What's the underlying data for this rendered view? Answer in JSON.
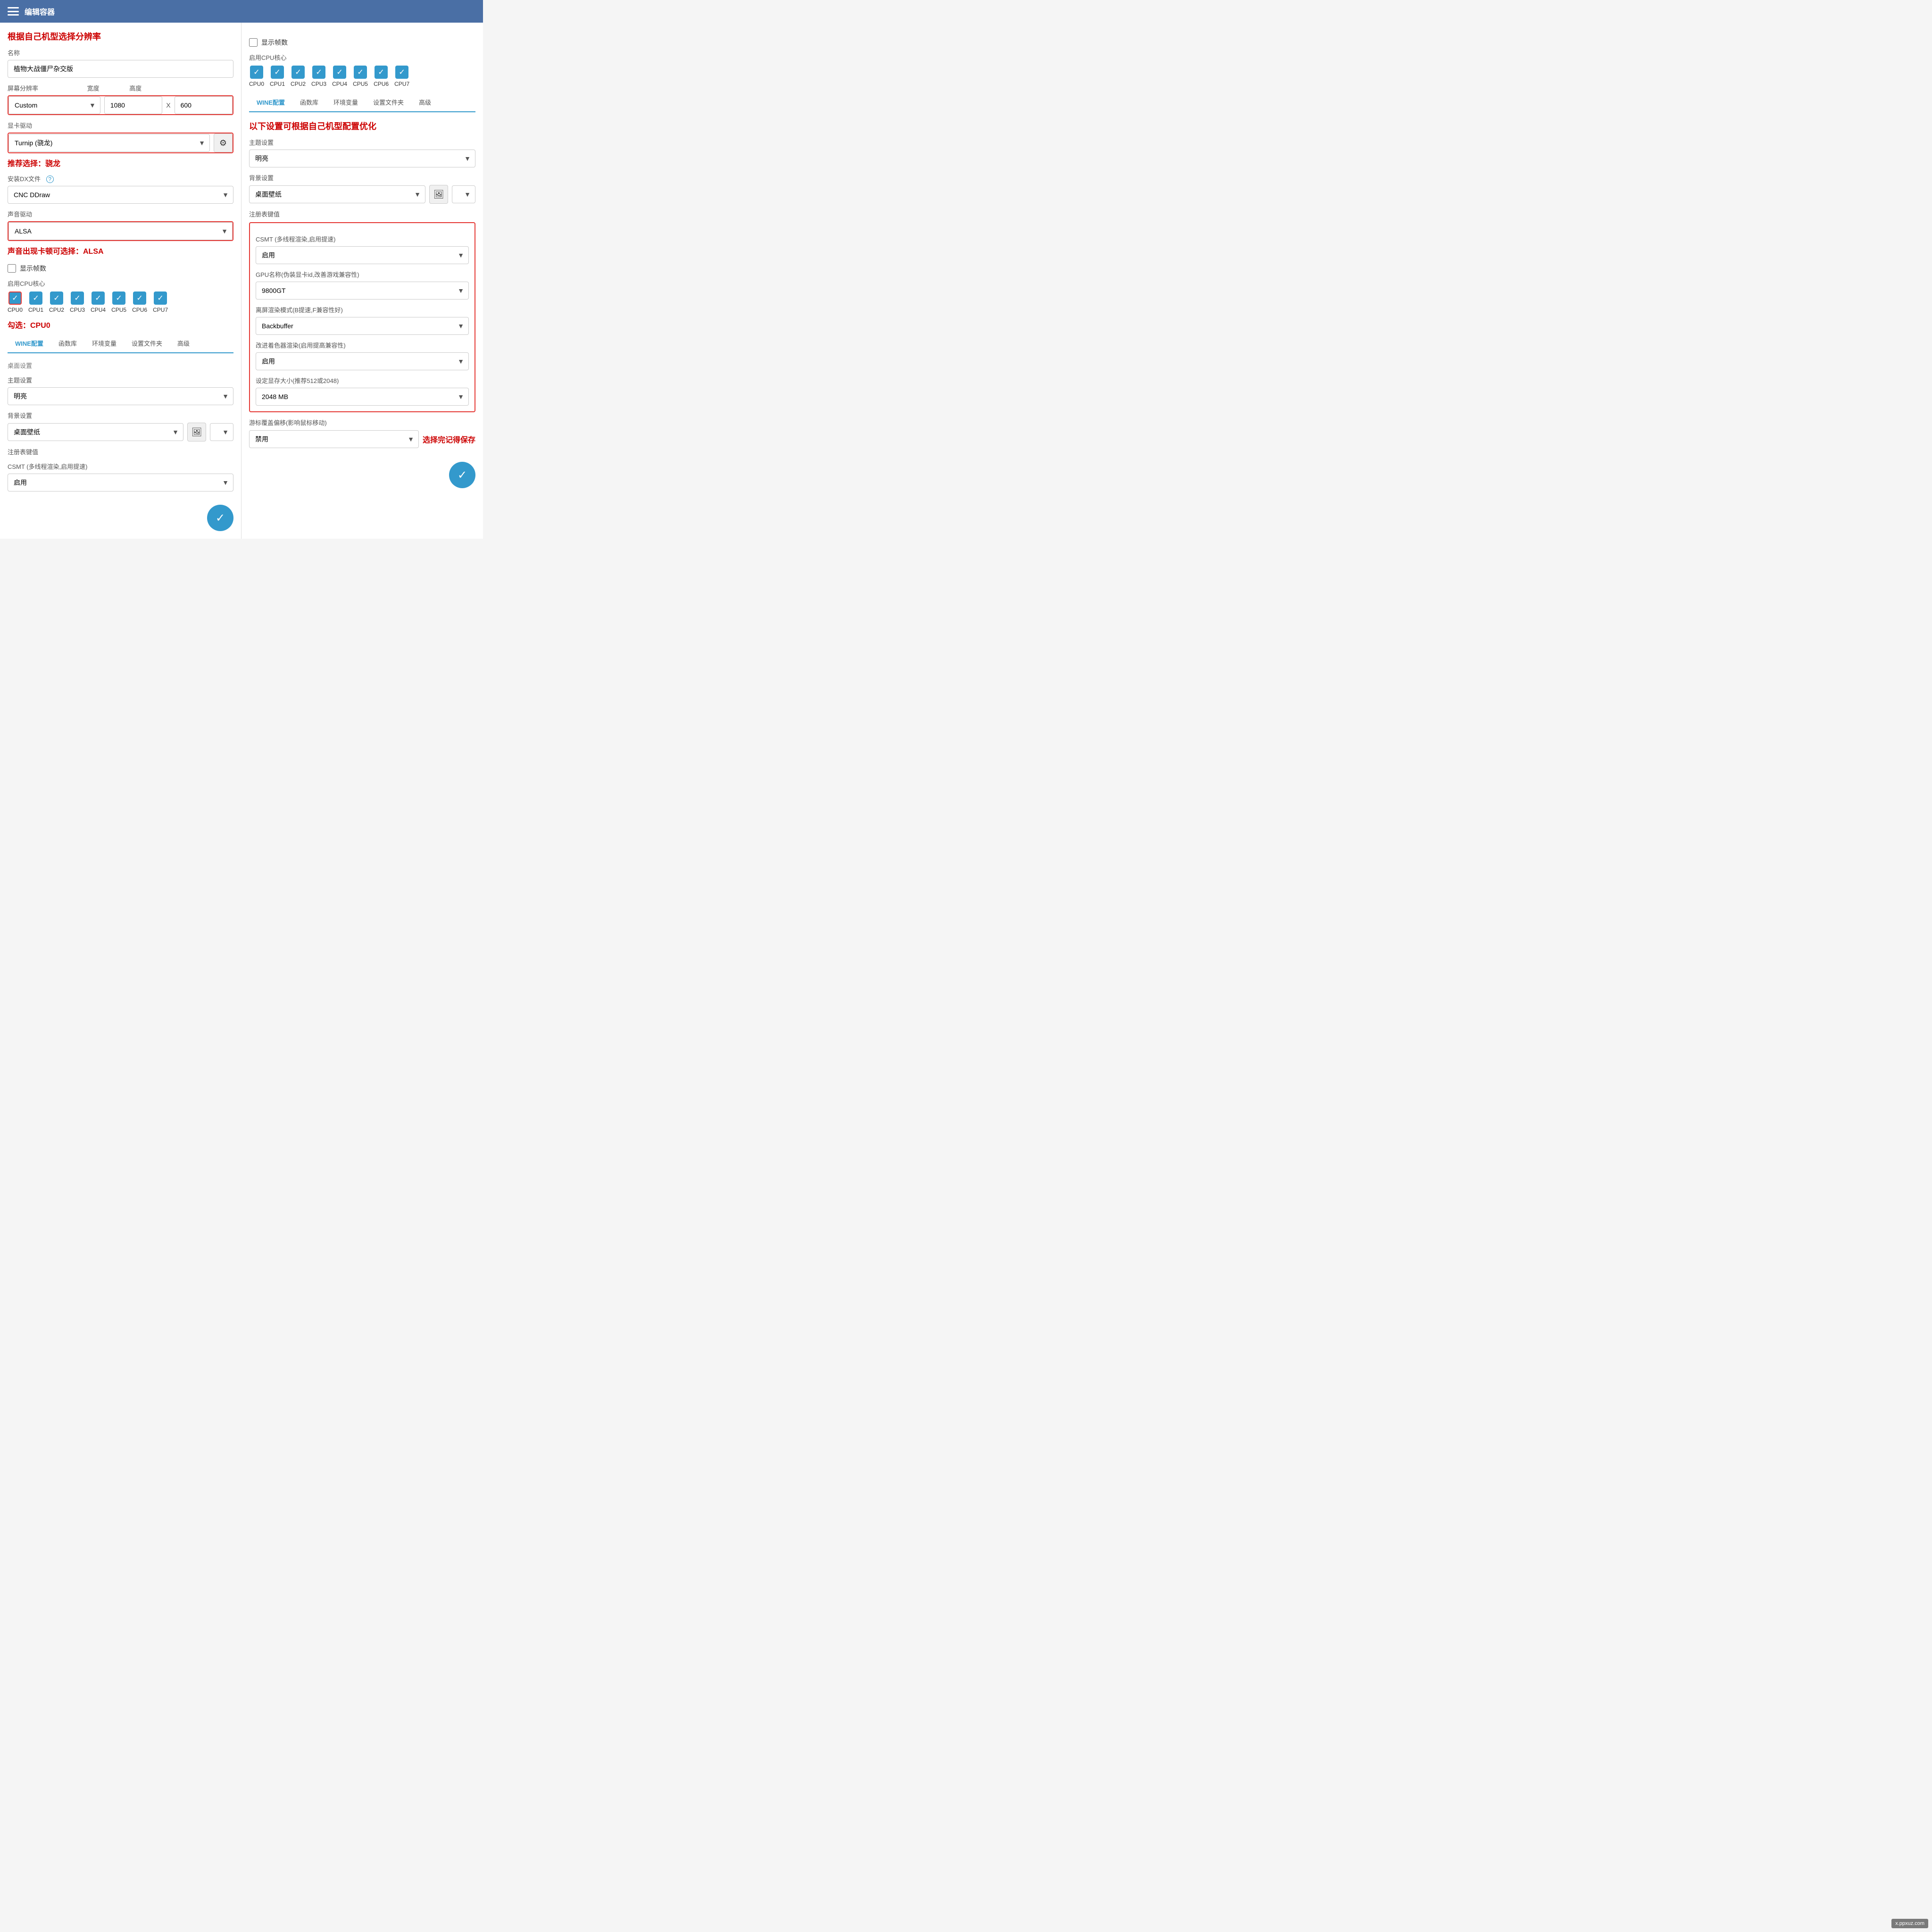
{
  "header": {
    "title": "编辑容器",
    "menu_icon": "menu-icon"
  },
  "left": {
    "annotation_top": "根据自己机型选择分辨率",
    "name_label": "名称",
    "name_value": "植物大战僵尸杂交版",
    "resolution_label": "屏幕分辨率",
    "resolution_width_label": "宽度",
    "resolution_height_label": "高度",
    "resolution_preset": "Custom",
    "resolution_width": "1080",
    "resolution_height": "600",
    "gpu_driver_label": "显卡驱动",
    "gpu_driver_value": "Turnip (骁龙)",
    "gpu_driver_note": "推荐选择：骁龙",
    "install_dx_label": "安装DX文件",
    "install_dx_value": "CNC DDraw",
    "audio_driver_label": "声音驱动",
    "audio_driver_value": "ALSA",
    "audio_note": "声音出现卡顿可选择：ALSA",
    "show_fps_label": "显示帧数",
    "enable_cpu_label": "启用CPU核心",
    "cpu_note": "勾选：CPU0",
    "cpu_items": [
      {
        "id": "CPU0",
        "checked": true
      },
      {
        "id": "CPU1",
        "checked": true
      },
      {
        "id": "CPU2",
        "checked": true
      },
      {
        "id": "CPU3",
        "checked": true
      },
      {
        "id": "CPU4",
        "checked": true
      },
      {
        "id": "CPU5",
        "checked": true
      },
      {
        "id": "CPU6",
        "checked": true
      },
      {
        "id": "CPU7",
        "checked": true
      }
    ],
    "tabs": [
      {
        "label": "WINE配置",
        "active": true
      },
      {
        "label": "函数库",
        "active": false
      },
      {
        "label": "环境变量",
        "active": false
      },
      {
        "label": "设置文件夹",
        "active": false
      },
      {
        "label": "高级",
        "active": false
      }
    ],
    "desktop_section": "桌面设置",
    "theme_label": "主题设置",
    "theme_value": "明亮",
    "bg_label": "背景设置",
    "bg_value": "桌面壁纸",
    "reg_key_label": "注册表键值",
    "csmt_label": "CSMT (多线程渲染,启用提速)",
    "csmt_value": "启用",
    "save_btn_label": "✓"
  },
  "right": {
    "show_fps_label": "显示帧数",
    "enable_cpu_label": "启用CPU核心",
    "cpu_items": [
      {
        "id": "CPU0",
        "checked": true
      },
      {
        "id": "CPU1",
        "checked": true
      },
      {
        "id": "CPU2",
        "checked": true
      },
      {
        "id": "CPU3",
        "checked": true
      },
      {
        "id": "CPU4",
        "checked": true
      },
      {
        "id": "CPU5",
        "checked": true
      },
      {
        "id": "CPU6",
        "checked": true
      },
      {
        "id": "CPU7",
        "checked": true
      }
    ],
    "tabs": [
      {
        "label": "WINE配置",
        "active": true
      },
      {
        "label": "函数库",
        "active": false
      },
      {
        "label": "环境变量",
        "active": false
      },
      {
        "label": "设置文件夹",
        "active": false
      },
      {
        "label": "高级",
        "active": false
      }
    ],
    "annotation_config": "以下设置可根据自己机型配置优化",
    "theme_label": "主题设置",
    "theme_value": "明亮",
    "bg_label": "背景设置",
    "bg_value": "桌面壁纸",
    "reg_key_label": "注册表键值",
    "csmt_label": "CSMT (多线程渲染,启用提速)",
    "csmt_value": "启用",
    "gpu_name_label": "GPU名称(伪装显卡id,改善游戏兼容性)",
    "gpu_name_value": "9800GT",
    "offscreen_label": "离屏渲染模式(B提速,F兼容性好)",
    "offscreen_value": "Backbuffer",
    "shader_label": "改进着色器渲染(启用提高兼容性)",
    "shader_value": "启用",
    "vram_label": "设定显存大小(推荐512或2048)",
    "vram_value": "2048 MB",
    "cursor_label": "游标覆盖偏移(影响鼠标移动)",
    "cursor_value": "禁用",
    "cursor_note": "选择完记得保存",
    "save_btn_label": "✓"
  },
  "watermark": "x.ppxuz.com"
}
